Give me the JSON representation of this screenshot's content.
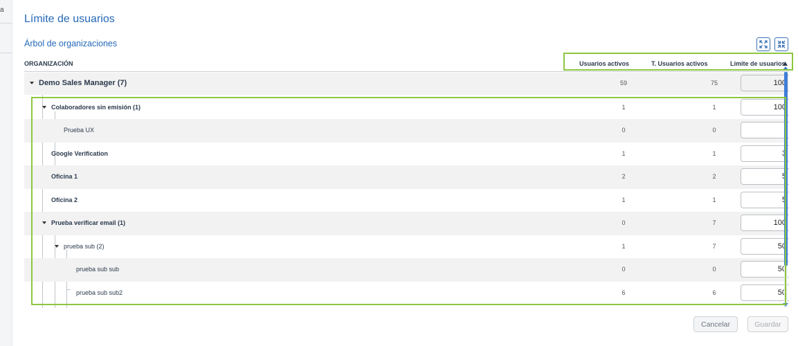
{
  "sidebar": {
    "fragment": "a"
  },
  "page": {
    "title": "Límite de usuarios",
    "section_title": "Árbol de organizaciones"
  },
  "toolbar": {
    "expand_icon": "expand-icon",
    "collapse_icon": "collapse-icon"
  },
  "columns": {
    "organization": "ORGANIZACIÓN",
    "active_users": "Usuarios activos",
    "total_active_users": "T. Usuarios activos",
    "user_limit": "Límite de usuarios",
    "sort": "ascending"
  },
  "rows": [
    {
      "name": "Demo Sales Manager (7)",
      "active": "59",
      "total": "75",
      "limit": "100",
      "level": 0,
      "expandable": true
    },
    {
      "name": "Colaboradores sin emisión (1)",
      "active": "1",
      "total": "1",
      "limit": "100",
      "level": 1,
      "expandable": true
    },
    {
      "name": "Prueba UX",
      "active": "0",
      "total": "0",
      "limit": "",
      "level": 2,
      "expandable": false
    },
    {
      "name": "Google Verification",
      "active": "1",
      "total": "1",
      "limit": "3",
      "level": 1,
      "expandable": false
    },
    {
      "name": "Oficina 1",
      "active": "2",
      "total": "2",
      "limit": "5",
      "level": 1,
      "expandable": false
    },
    {
      "name": "Oficina 2",
      "active": "1",
      "total": "1",
      "limit": "5",
      "level": 1,
      "expandable": false
    },
    {
      "name": "Prueba verificar email (1)",
      "active": "0",
      "total": "7",
      "limit": "100",
      "level": 1,
      "expandable": true
    },
    {
      "name": "prueba sub (2)",
      "active": "1",
      "total": "7",
      "limit": "50",
      "level": 2,
      "expandable": true
    },
    {
      "name": "prueba sub sub",
      "active": "0",
      "total": "0",
      "limit": "50",
      "level": 3,
      "expandable": false
    },
    {
      "name": "prueba sub sub2",
      "active": "6",
      "total": "6",
      "limit": "50",
      "level": 3,
      "expandable": false
    }
  ],
  "footer": {
    "cancel": "Cancelar",
    "save": "Guardar"
  },
  "colors": {
    "accent": "#2569b8",
    "highlight": "#8cc63f",
    "scroll": "#3f7dd6"
  }
}
